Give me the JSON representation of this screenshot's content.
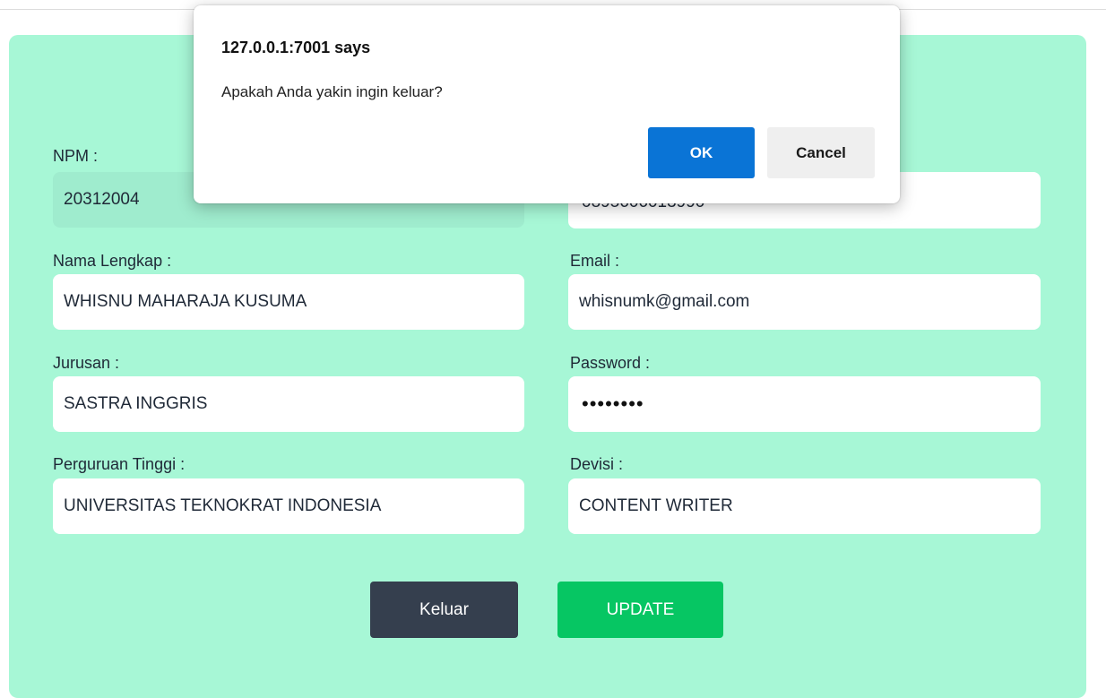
{
  "form": {
    "npm_label": "NPM :",
    "npm_value": "20312004",
    "phone_value": "0895606013990",
    "nama_label": "Nama Lengkap :",
    "nama_value": "WHISNU MAHARAJA KUSUMA",
    "email_label": "Email :",
    "email_value": "whisnumk@gmail.com",
    "jurusan_label": "Jurusan :",
    "jurusan_value": "SASTRA INGGRIS",
    "password_label": "Password :",
    "password_value": "••••••••",
    "pt_label": "Perguruan Tinggi :",
    "pt_value": "UNIVERSITAS TEKNOKRAT INDONESIA",
    "devisi_label": "Devisi :",
    "devisi_value": "CONTENT WRITER"
  },
  "actions": {
    "keluar_label": "Keluar",
    "update_label": "UPDATE"
  },
  "dialog": {
    "title": "127.0.0.1:7001 says",
    "message": "Apakah Anda yakin ingin keluar?",
    "ok_label": "OK",
    "cancel_label": "Cancel"
  },
  "colors": {
    "card_bg": "#a7f7d6",
    "keluar_bg": "#353f4e",
    "update_bg": "#06c663",
    "ok_bg": "#0a74d6"
  }
}
